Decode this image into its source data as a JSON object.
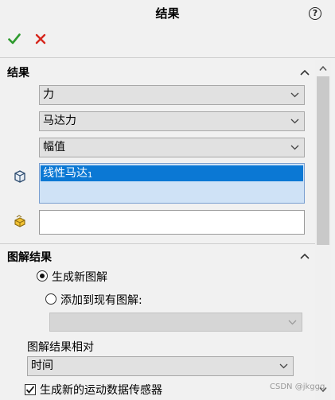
{
  "header": {
    "title": "结果",
    "help_glyph": "?"
  },
  "results_group": {
    "title": "结果",
    "category_combo": "力",
    "subcategory_combo": "马达力",
    "component_combo": "幅值",
    "selected_item": {
      "label": "线性马达",
      "index": "1"
    }
  },
  "plot_group": {
    "title": "图解结果",
    "radio_new_plot": {
      "label": "生成新图解",
      "checked": true
    },
    "radio_add_existing": {
      "label": "添加到现有图解:",
      "checked": false
    },
    "existing_plot_combo": "",
    "plot_relative_label": "图解结果相对",
    "plot_relative_combo": "时间",
    "create_sensor_checkbox": {
      "label": "生成新的运动数据传感器",
      "checked": true
    }
  },
  "watermark": "CSDN @jkggg",
  "colors": {
    "ok": "#2e9a2e",
    "cancel": "#d6271d",
    "selection": "#0b78d4",
    "listbox": "#cfe2f6"
  }
}
